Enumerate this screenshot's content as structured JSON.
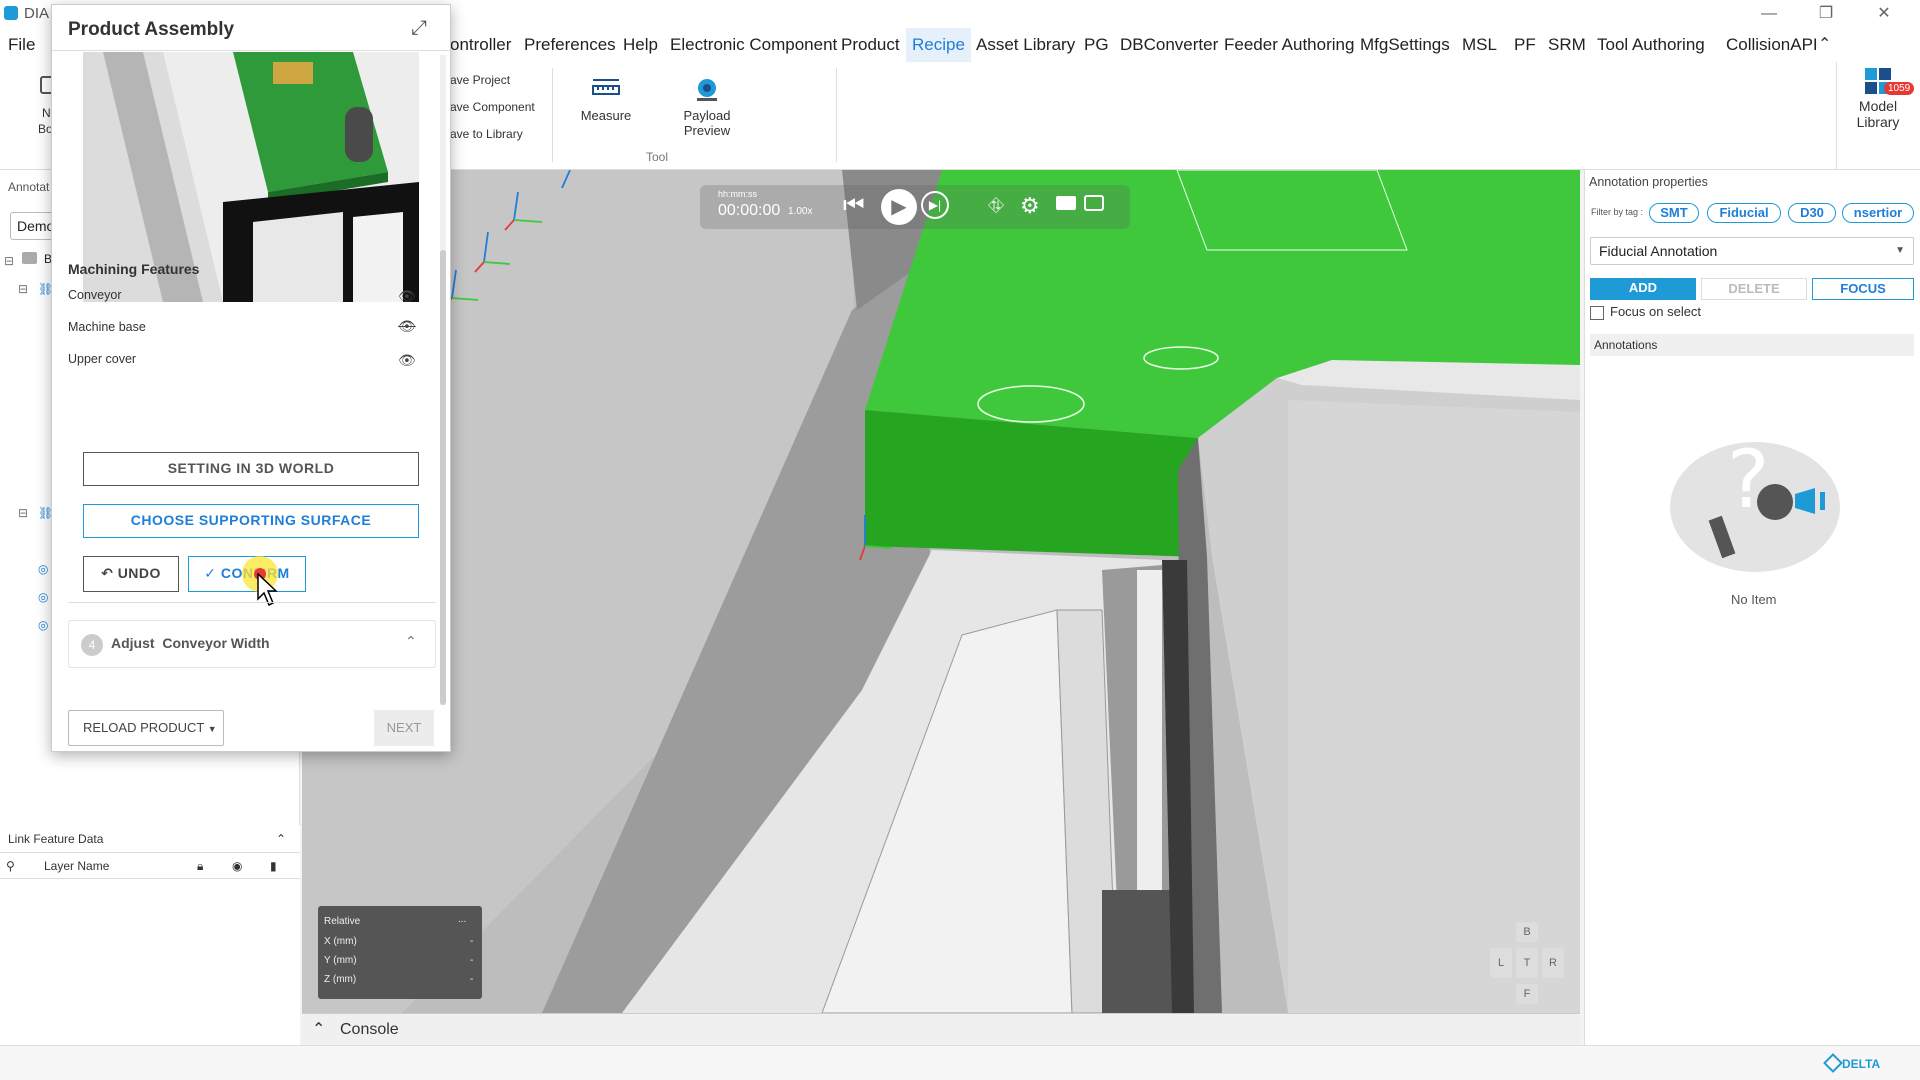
{
  "window": {
    "app_title": "DIA",
    "min": "—",
    "restore": "❐",
    "close": "✕"
  },
  "menu": {
    "items": [
      "File",
      "Controller",
      "Preferences",
      "Help",
      "Electronic Component",
      "Product",
      "Recipe",
      "Asset Library",
      "PG",
      "DBConverter",
      "Feeder Authoring",
      "MfgSettings",
      "MSL",
      "PF",
      "SRM",
      "Tool Authoring",
      "CollisionAPI"
    ],
    "active": "Recipe"
  },
  "ribbon": {
    "save_project": "ave Project",
    "save_component": "ave Component",
    "save_library": "ave to Library",
    "measure": "Measure",
    "payload_preview_1": "Payload",
    "payload_preview_2": "Preview",
    "tool_group": "Tool",
    "model_library_1": "Model",
    "model_library_2": "Library",
    "model_library_badge": "1059",
    "left_btn_a": "N",
    "left_btn_b": "Bo"
  },
  "left_panel": {
    "annotation_label": "Annotat",
    "demo_select": "Demo",
    "tree_root_label": "B"
  },
  "dialog": {
    "title": "Product Assembly",
    "section_title": "Machining Features",
    "features": [
      {
        "label": "Conveyor",
        "visible": "visible"
      },
      {
        "label": "Machine base",
        "visible": "hidden"
      },
      {
        "label": "Upper cover",
        "visible": "visible"
      }
    ],
    "setting_button": "SETTING IN 3D WORLD",
    "choose_button": "CHOOSE SUPPORTING SURFACE",
    "undo_button": "UNDO",
    "confirm_button": "CONFIRM",
    "step_number": "4",
    "step_label": "Adjust  Conveyor Width",
    "reload_button": "RELOAD PRODUCT",
    "next_button": "NEXT"
  },
  "playback": {
    "time_format": "hh:mm:ss",
    "time": "00:00:00",
    "speed": "1.00x"
  },
  "coords": {
    "mode": "Relative",
    "menu": "...",
    "x_label": "X (mm)",
    "y_label": "Y (mm)",
    "z_label": "Z (mm)",
    "x_value": "-",
    "y_value": "-",
    "z_value": "-"
  },
  "viewcube": {
    "top": "B",
    "left": "L",
    "center": "T",
    "right": "R",
    "bottom": "F"
  },
  "link_feature": {
    "title": "Link Feature Data",
    "col_layer": "Layer Name"
  },
  "console": {
    "label": "Console"
  },
  "right_panel": {
    "title": "Annotation properties",
    "filter_label": "Filter by tag :",
    "tags": [
      "SMT",
      "Fiducial",
      "D30",
      "nsertior"
    ],
    "annotation_type": "Fiducial Annotation",
    "add": "ADD",
    "delete": "DELETE",
    "focus": "FOCUS",
    "focus_on_select": "Focus on select",
    "annotations_header": "Annotations",
    "empty_text": "No Item"
  },
  "status": {
    "brand": "DELTA"
  },
  "colors": {
    "accent": "#1e7ed8",
    "green": "#3fc83c",
    "brand_blue": "#1e9ad6"
  }
}
